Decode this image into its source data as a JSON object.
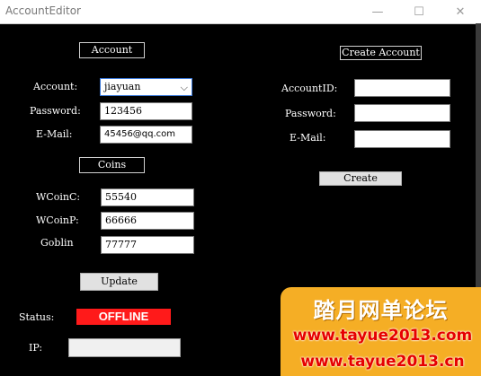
{
  "window": {
    "title": "AccountEditor",
    "min_glyph": "—",
    "max_glyph": "☐",
    "close_glyph": "✕"
  },
  "account_section": {
    "header": "Account",
    "account_label": "Account:",
    "account_value": "jiayuan",
    "password_label": "Password:",
    "password_value": "123456",
    "email_label": "E-Mail:",
    "email_value": "45456@qq.com"
  },
  "coins_section": {
    "header": "Coins",
    "wcoinc_label": "WCoinC:",
    "wcoinc_value": "55540",
    "wcoinp_label": "WCoinP:",
    "wcoinp_value": "66666",
    "goblin_label": "Goblin",
    "goblin_value": "77777",
    "update_label": "Update"
  },
  "create_section": {
    "header": "Create Account",
    "accountid_label": "AccountID:",
    "accountid_value": "",
    "password_label": "Password:",
    "password_value": "",
    "email_label": "E-Mail:",
    "email_value": "",
    "create_label": "Create"
  },
  "status": {
    "label": "Status:",
    "value": "OFFLINE",
    "color": "#ff1a1a"
  },
  "ip": {
    "label": "IP:",
    "value": ""
  },
  "watermark": {
    "title": "踏月网单论坛",
    "line1": "www.tayue2013.com",
    "line2": "www.tayue2013.cn",
    "bg": "#f5ae25"
  }
}
